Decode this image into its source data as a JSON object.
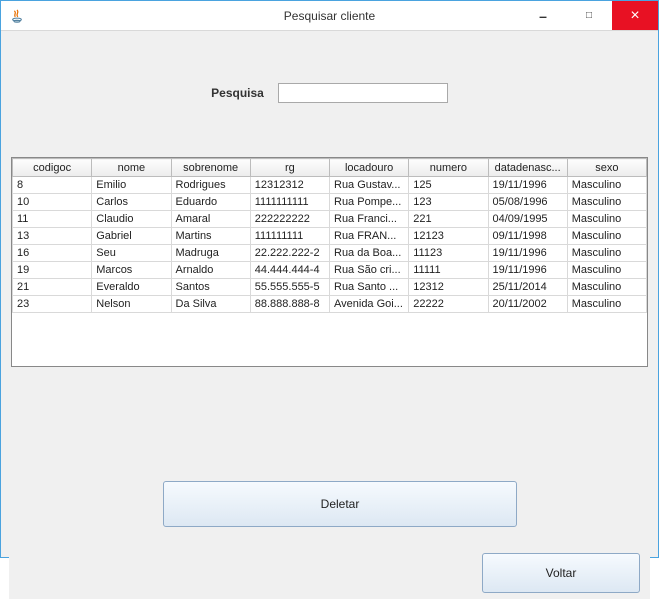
{
  "window": {
    "title": "Pesquisar cliente",
    "minimize": "–",
    "maximize": "□",
    "close": "×"
  },
  "search": {
    "label": "Pesquisa",
    "value": ""
  },
  "table": {
    "columns": [
      "codigoc",
      "nome",
      "sobrenome",
      "rg",
      "locadouro",
      "numero",
      "datadenasc...",
      "sexo"
    ],
    "rows": [
      {
        "codigoc": "8",
        "nome": "Emilio",
        "sobrenome": "Rodrigues",
        "rg": "12312312",
        "locadouro": "Rua Gustav...",
        "numero": "125",
        "datadenasc": "19/11/1996",
        "sexo": "Masculino"
      },
      {
        "codigoc": "10",
        "nome": "Carlos",
        "sobrenome": "Eduardo",
        "rg": "1111111111",
        "locadouro": "Rua Pompe...",
        "numero": "123",
        "datadenasc": "05/08/1996",
        "sexo": "Masculino"
      },
      {
        "codigoc": "11",
        "nome": "Claudio",
        "sobrenome": "Amaral",
        "rg": "222222222",
        "locadouro": "Rua Franci...",
        "numero": "221",
        "datadenasc": "04/09/1995",
        "sexo": "Masculino"
      },
      {
        "codigoc": "13",
        "nome": "Gabriel",
        "sobrenome": "Martins",
        "rg": "111111111",
        "locadouro": "Rua FRAN...",
        "numero": "12123",
        "datadenasc": "09/11/1998",
        "sexo": "Masculino"
      },
      {
        "codigoc": "16",
        "nome": "Seu",
        "sobrenome": "Madruga",
        "rg": "22.222.222-2",
        "locadouro": "Rua da Boa...",
        "numero": "11123",
        "datadenasc": "19/11/1996",
        "sexo": "Masculino"
      },
      {
        "codigoc": "19",
        "nome": "Marcos",
        "sobrenome": "Arnaldo",
        "rg": "44.444.444-4",
        "locadouro": "Rua São cri...",
        "numero": "11111",
        "datadenasc": "19/11/1996",
        "sexo": "Masculino"
      },
      {
        "codigoc": "21",
        "nome": "Everaldo",
        "sobrenome": "Santos",
        "rg": "55.555.555-5",
        "locadouro": "Rua Santo ...",
        "numero": "12312",
        "datadenasc": "25/11/2014",
        "sexo": "Masculino"
      },
      {
        "codigoc": "23",
        "nome": "Nelson",
        "sobrenome": "Da Silva",
        "rg": "88.888.888-8",
        "locadouro": "Avenida Goi...",
        "numero": "22222",
        "datadenasc": "20/11/2002",
        "sexo": "Masculino"
      }
    ]
  },
  "buttons": {
    "deletar": "Deletar",
    "voltar": "Voltar"
  }
}
